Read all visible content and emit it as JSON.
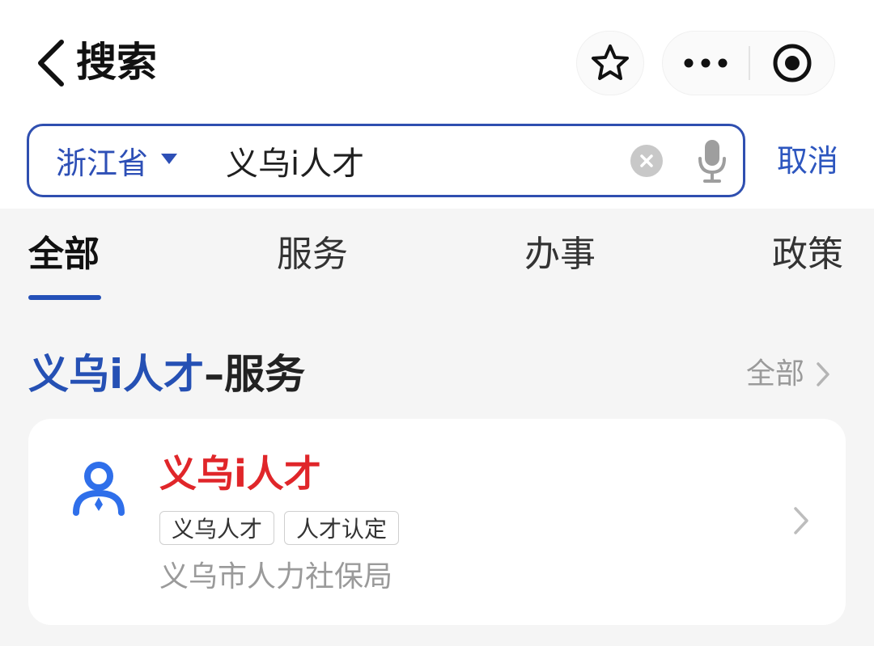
{
  "header": {
    "back_icon": "chevron-left-icon",
    "title": "搜索",
    "star_icon": "star-outline-icon",
    "more_icon": "more-dots-icon",
    "close_icon": "target-circle-icon"
  },
  "search": {
    "region": "浙江省",
    "region_icon": "caret-down-icon",
    "value": "义乌i人才",
    "placeholder": "",
    "clear_icon": "clear-circle-icon",
    "mic_icon": "microphone-icon",
    "cancel_label": "取消"
  },
  "tabs": [
    {
      "label": "全部",
      "active": true
    },
    {
      "label": "服务",
      "active": false
    },
    {
      "label": "办事",
      "active": false
    },
    {
      "label": "政策",
      "active": false
    }
  ],
  "section": {
    "title_keyword": "义乌i人才",
    "title_suffix": "–服务",
    "all_label": "全部",
    "all_icon": "chevron-right-icon"
  },
  "result": {
    "icon": "person-badge-icon",
    "title": "义乌i人才",
    "tags": [
      "义乌人才",
      "人才认定"
    ],
    "provider": "义乌市人力社保局",
    "chevron_icon": "chevron-right-icon"
  },
  "colors": {
    "accent": "#2d4fb6",
    "result_title": "#e0262a",
    "background": "#f5f5f5",
    "muted": "#9a9a9a"
  }
}
